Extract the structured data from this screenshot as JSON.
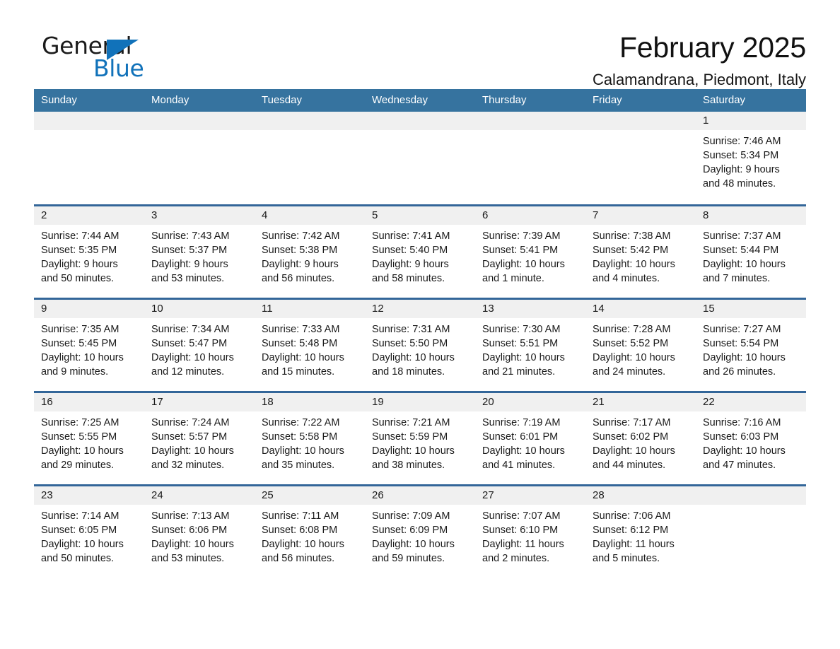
{
  "brand": {
    "name_part1": "General",
    "name_part2": "Blue",
    "accent_color": "#1172ba",
    "triangle_icon": "triangle-icon"
  },
  "header": {
    "title": "February 2025",
    "subtitle": "Calamandrana, Piedmont, Italy"
  },
  "calendar": {
    "header_color": "#36739f",
    "row_border_color": "#336699",
    "daynum_band_color": "#f0f0f0",
    "weekdays": [
      "Sunday",
      "Monday",
      "Tuesday",
      "Wednesday",
      "Thursday",
      "Friday",
      "Saturday"
    ],
    "weeks": [
      [
        {
          "day": "",
          "sunrise": "",
          "sunset": "",
          "daylight": "",
          "empty": true
        },
        {
          "day": "",
          "sunrise": "",
          "sunset": "",
          "daylight": "",
          "empty": true
        },
        {
          "day": "",
          "sunrise": "",
          "sunset": "",
          "daylight": "",
          "empty": true
        },
        {
          "day": "",
          "sunrise": "",
          "sunset": "",
          "daylight": "",
          "empty": true
        },
        {
          "day": "",
          "sunrise": "",
          "sunset": "",
          "daylight": "",
          "empty": true
        },
        {
          "day": "",
          "sunrise": "",
          "sunset": "",
          "daylight": "",
          "empty": true
        },
        {
          "day": "1",
          "sunrise": "Sunrise: 7:46 AM",
          "sunset": "Sunset: 5:34 PM",
          "daylight": "Daylight: 9 hours and 48 minutes.",
          "empty": false
        }
      ],
      [
        {
          "day": "2",
          "sunrise": "Sunrise: 7:44 AM",
          "sunset": "Sunset: 5:35 PM",
          "daylight": "Daylight: 9 hours and 50 minutes.",
          "empty": false
        },
        {
          "day": "3",
          "sunrise": "Sunrise: 7:43 AM",
          "sunset": "Sunset: 5:37 PM",
          "daylight": "Daylight: 9 hours and 53 minutes.",
          "empty": false
        },
        {
          "day": "4",
          "sunrise": "Sunrise: 7:42 AM",
          "sunset": "Sunset: 5:38 PM",
          "daylight": "Daylight: 9 hours and 56 minutes.",
          "empty": false
        },
        {
          "day": "5",
          "sunrise": "Sunrise: 7:41 AM",
          "sunset": "Sunset: 5:40 PM",
          "daylight": "Daylight: 9 hours and 58 minutes.",
          "empty": false
        },
        {
          "day": "6",
          "sunrise": "Sunrise: 7:39 AM",
          "sunset": "Sunset: 5:41 PM",
          "daylight": "Daylight: 10 hours and 1 minute.",
          "empty": false
        },
        {
          "day": "7",
          "sunrise": "Sunrise: 7:38 AM",
          "sunset": "Sunset: 5:42 PM",
          "daylight": "Daylight: 10 hours and 4 minutes.",
          "empty": false
        },
        {
          "day": "8",
          "sunrise": "Sunrise: 7:37 AM",
          "sunset": "Sunset: 5:44 PM",
          "daylight": "Daylight: 10 hours and 7 minutes.",
          "empty": false
        }
      ],
      [
        {
          "day": "9",
          "sunrise": "Sunrise: 7:35 AM",
          "sunset": "Sunset: 5:45 PM",
          "daylight": "Daylight: 10 hours and 9 minutes.",
          "empty": false
        },
        {
          "day": "10",
          "sunrise": "Sunrise: 7:34 AM",
          "sunset": "Sunset: 5:47 PM",
          "daylight": "Daylight: 10 hours and 12 minutes.",
          "empty": false
        },
        {
          "day": "11",
          "sunrise": "Sunrise: 7:33 AM",
          "sunset": "Sunset: 5:48 PM",
          "daylight": "Daylight: 10 hours and 15 minutes.",
          "empty": false
        },
        {
          "day": "12",
          "sunrise": "Sunrise: 7:31 AM",
          "sunset": "Sunset: 5:50 PM",
          "daylight": "Daylight: 10 hours and 18 minutes.",
          "empty": false
        },
        {
          "day": "13",
          "sunrise": "Sunrise: 7:30 AM",
          "sunset": "Sunset: 5:51 PM",
          "daylight": "Daylight: 10 hours and 21 minutes.",
          "empty": false
        },
        {
          "day": "14",
          "sunrise": "Sunrise: 7:28 AM",
          "sunset": "Sunset: 5:52 PM",
          "daylight": "Daylight: 10 hours and 24 minutes.",
          "empty": false
        },
        {
          "day": "15",
          "sunrise": "Sunrise: 7:27 AM",
          "sunset": "Sunset: 5:54 PM",
          "daylight": "Daylight: 10 hours and 26 minutes.",
          "empty": false
        }
      ],
      [
        {
          "day": "16",
          "sunrise": "Sunrise: 7:25 AM",
          "sunset": "Sunset: 5:55 PM",
          "daylight": "Daylight: 10 hours and 29 minutes.",
          "empty": false
        },
        {
          "day": "17",
          "sunrise": "Sunrise: 7:24 AM",
          "sunset": "Sunset: 5:57 PM",
          "daylight": "Daylight: 10 hours and 32 minutes.",
          "empty": false
        },
        {
          "day": "18",
          "sunrise": "Sunrise: 7:22 AM",
          "sunset": "Sunset: 5:58 PM",
          "daylight": "Daylight: 10 hours and 35 minutes.",
          "empty": false
        },
        {
          "day": "19",
          "sunrise": "Sunrise: 7:21 AM",
          "sunset": "Sunset: 5:59 PM",
          "daylight": "Daylight: 10 hours and 38 minutes.",
          "empty": false
        },
        {
          "day": "20",
          "sunrise": "Sunrise: 7:19 AM",
          "sunset": "Sunset: 6:01 PM",
          "daylight": "Daylight: 10 hours and 41 minutes.",
          "empty": false
        },
        {
          "day": "21",
          "sunrise": "Sunrise: 7:17 AM",
          "sunset": "Sunset: 6:02 PM",
          "daylight": "Daylight: 10 hours and 44 minutes.",
          "empty": false
        },
        {
          "day": "22",
          "sunrise": "Sunrise: 7:16 AM",
          "sunset": "Sunset: 6:03 PM",
          "daylight": "Daylight: 10 hours and 47 minutes.",
          "empty": false
        }
      ],
      [
        {
          "day": "23",
          "sunrise": "Sunrise: 7:14 AM",
          "sunset": "Sunset: 6:05 PM",
          "daylight": "Daylight: 10 hours and 50 minutes.",
          "empty": false
        },
        {
          "day": "24",
          "sunrise": "Sunrise: 7:13 AM",
          "sunset": "Sunset: 6:06 PM",
          "daylight": "Daylight: 10 hours and 53 minutes.",
          "empty": false
        },
        {
          "day": "25",
          "sunrise": "Sunrise: 7:11 AM",
          "sunset": "Sunset: 6:08 PM",
          "daylight": "Daylight: 10 hours and 56 minutes.",
          "empty": false
        },
        {
          "day": "26",
          "sunrise": "Sunrise: 7:09 AM",
          "sunset": "Sunset: 6:09 PM",
          "daylight": "Daylight: 10 hours and 59 minutes.",
          "empty": false
        },
        {
          "day": "27",
          "sunrise": "Sunrise: 7:07 AM",
          "sunset": "Sunset: 6:10 PM",
          "daylight": "Daylight: 11 hours and 2 minutes.",
          "empty": false
        },
        {
          "day": "28",
          "sunrise": "Sunrise: 7:06 AM",
          "sunset": "Sunset: 6:12 PM",
          "daylight": "Daylight: 11 hours and 5 minutes.",
          "empty": false
        },
        {
          "day": "",
          "sunrise": "",
          "sunset": "",
          "daylight": "",
          "empty": true
        }
      ]
    ]
  }
}
